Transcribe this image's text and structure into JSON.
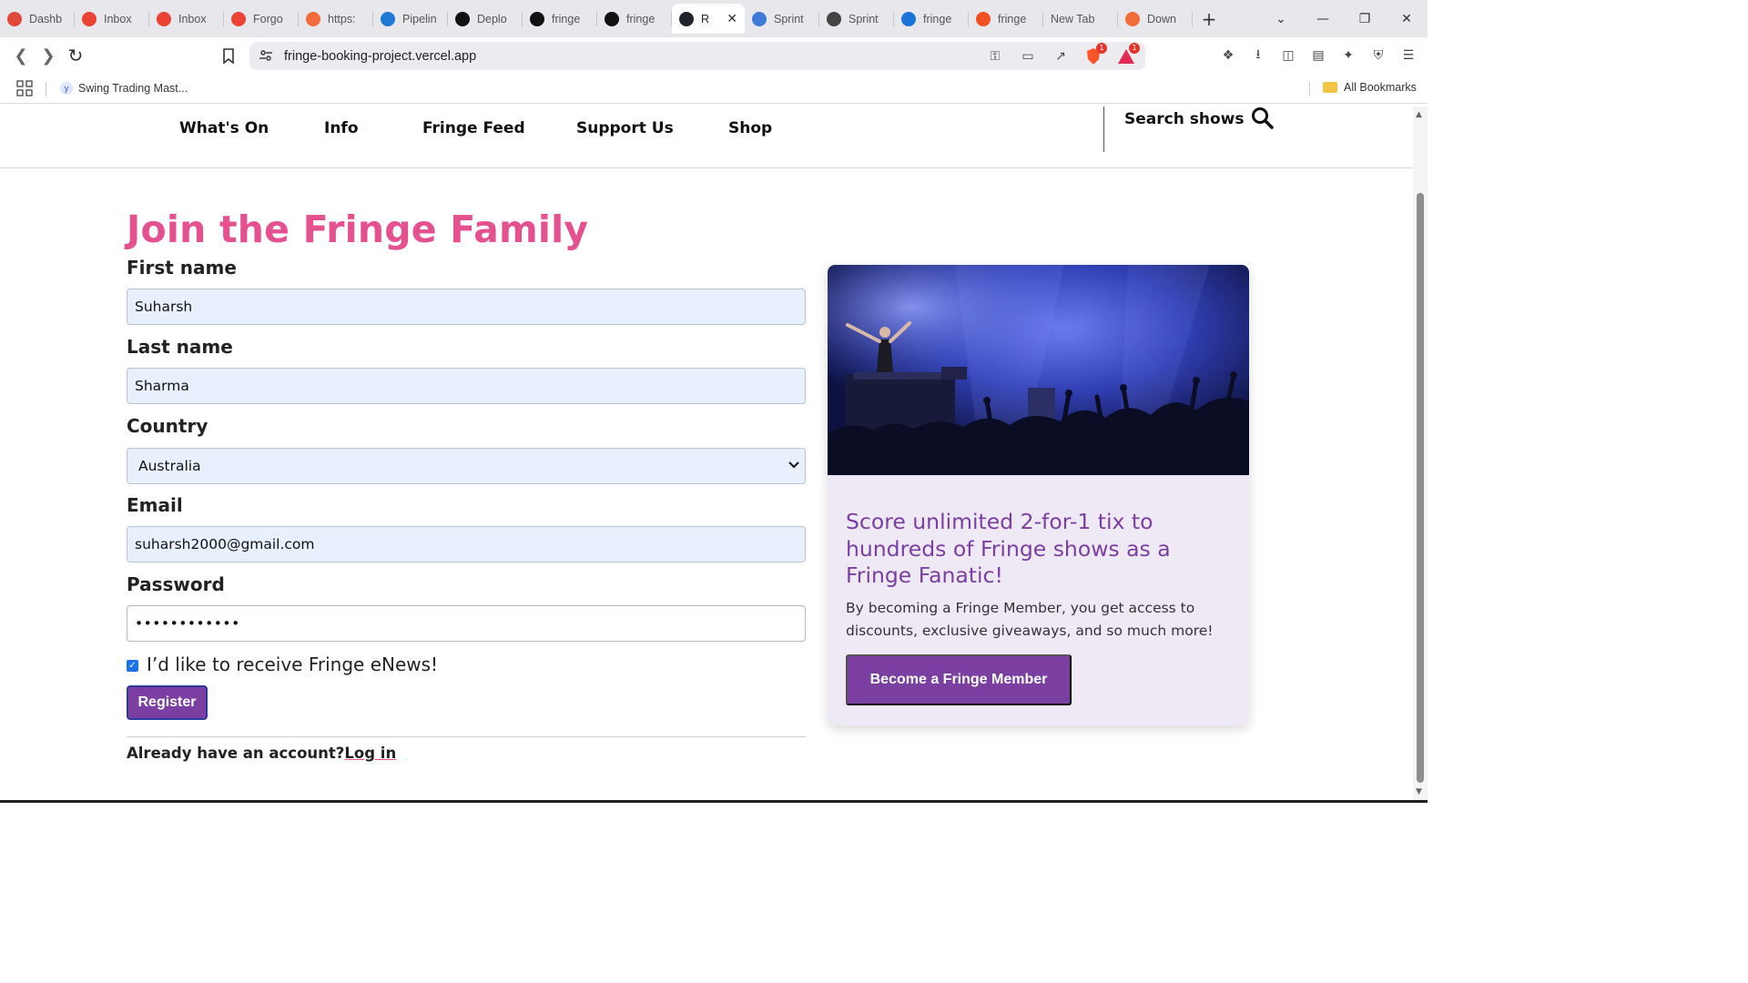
{
  "browser": {
    "tabs": [
      {
        "label": "Dashb",
        "icon": "dashboard-icon",
        "color": "#e0483c"
      },
      {
        "label": "Inbox",
        "icon": "gmail-icon",
        "color": "#ea4335"
      },
      {
        "label": "Inbox",
        "icon": "gmail-icon",
        "color": "#ea4335"
      },
      {
        "label": "Forgo",
        "icon": "gmail-icon",
        "color": "#ea4335"
      },
      {
        "label": "https:",
        "icon": "postman-icon",
        "color": "#f26b3a"
      },
      {
        "label": "Pipelin",
        "icon": "azure-devops-icon",
        "color": "#1e78d4"
      },
      {
        "label": "Deplo",
        "icon": "vercel-icon",
        "color": "#111111"
      },
      {
        "label": "fringe",
        "icon": "vercel-icon",
        "color": "#111111"
      },
      {
        "label": "fringe",
        "icon": "vercel-icon",
        "color": "#111111"
      },
      {
        "label": "R",
        "icon": "react-icon",
        "color": "#20232a",
        "active": true
      },
      {
        "label": "Sprint",
        "icon": "search-engine-icon",
        "color": "#3f7ad6"
      },
      {
        "label": "Sprint",
        "icon": "github-icon",
        "color": "#444444"
      },
      {
        "label": "fringe",
        "icon": "azure-icon",
        "color": "#1b74d8"
      },
      {
        "label": "fringe",
        "icon": "microsoft-icon",
        "color": "#f25022"
      },
      {
        "label": "New Tab",
        "icon": "",
        "color": ""
      },
      {
        "label": "Down",
        "icon": "postman-icon",
        "color": "#f26b3a"
      }
    ],
    "url": "fringe-booking-project.vercel.app",
    "badges": {
      "shield": "1",
      "rewards": "1"
    },
    "bookmarks": {
      "item1": "Swing Trading Mast...",
      "all": "All Bookmarks"
    }
  },
  "site_nav": {
    "links": [
      "What's On",
      "Info",
      "Fringe Feed",
      "Support Us",
      "Shop"
    ],
    "search_label": "Search shows"
  },
  "form": {
    "title": "Join the Fringe Family",
    "first_name_label": "First name",
    "first_name_value": "Suharsh",
    "last_name_label": "Last name",
    "last_name_value": "Sharma",
    "country_label": "Country",
    "country_value": "Australia",
    "email_label": "Email",
    "email_value": "suharsh2000@gmail.com",
    "password_label": "Password",
    "password_value": "••••••••••••",
    "enews_label": "I’d like to receive Fringe eNews!",
    "enews_checked": true,
    "register_label": "Register",
    "login_prompt": "Already have an account?",
    "login_link": "Log in"
  },
  "promo": {
    "heading": "Score unlimited 2-for-1 tix to hundreds of Fringe shows as a Fringe Fanatic!",
    "text": "By becoming a Fringe Member, you get access to discounts, exclusive giveaways, and so much more!",
    "button": "Become a Fringe Member"
  },
  "colors": {
    "accent_pink": "#e5508f",
    "accent_purple": "#7a3fa0",
    "promo_bg": "#efe8f5",
    "autofill_bg": "#e8f0fe"
  }
}
